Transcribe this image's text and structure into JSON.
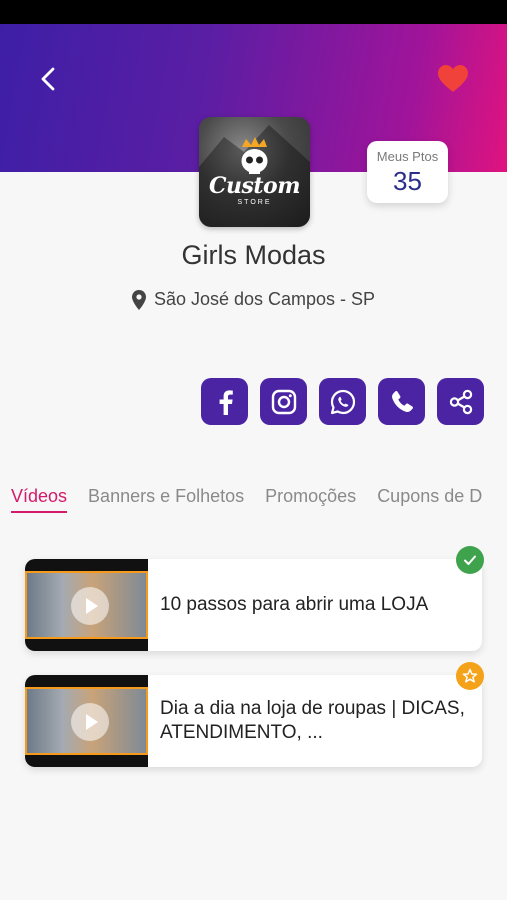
{
  "header": {
    "back_icon": "chevron-left-icon",
    "favorite_icon": "heart-icon",
    "gradient_colors": [
      "#3d1fa6",
      "#e0137f"
    ]
  },
  "store": {
    "logo_text": "Custom",
    "logo_subtext": "STORE",
    "name": "Girls Modas",
    "location": "São José dos Campos - SP"
  },
  "points": {
    "label": "Meus Ptos",
    "value": "35"
  },
  "social": [
    {
      "id": "facebook",
      "icon": "facebook-icon"
    },
    {
      "id": "instagram",
      "icon": "instagram-icon"
    },
    {
      "id": "whatsapp",
      "icon": "whatsapp-icon"
    },
    {
      "id": "phone",
      "icon": "phone-icon"
    },
    {
      "id": "share",
      "icon": "share-icon"
    }
  ],
  "tabs": [
    {
      "label": "Vídeos",
      "active": true
    },
    {
      "label": "Banners e Folhetos",
      "active": false
    },
    {
      "label": "Promoções",
      "active": false
    },
    {
      "label": "Cupons de D",
      "active": false
    }
  ],
  "videos": [
    {
      "title": "10 passos para abrir uma LOJA",
      "badge": "check-icon",
      "badge_color": "#3fa34d"
    },
    {
      "title": "Dia a dia na loja de roupas | DICAS, ATENDIMENTO, ...",
      "badge": "star-icon",
      "badge_color": "#f4a21a"
    }
  ],
  "colors": {
    "accent": "#d31b6b",
    "social_button": "#4a24a3",
    "points_value": "#2b2f8a"
  }
}
